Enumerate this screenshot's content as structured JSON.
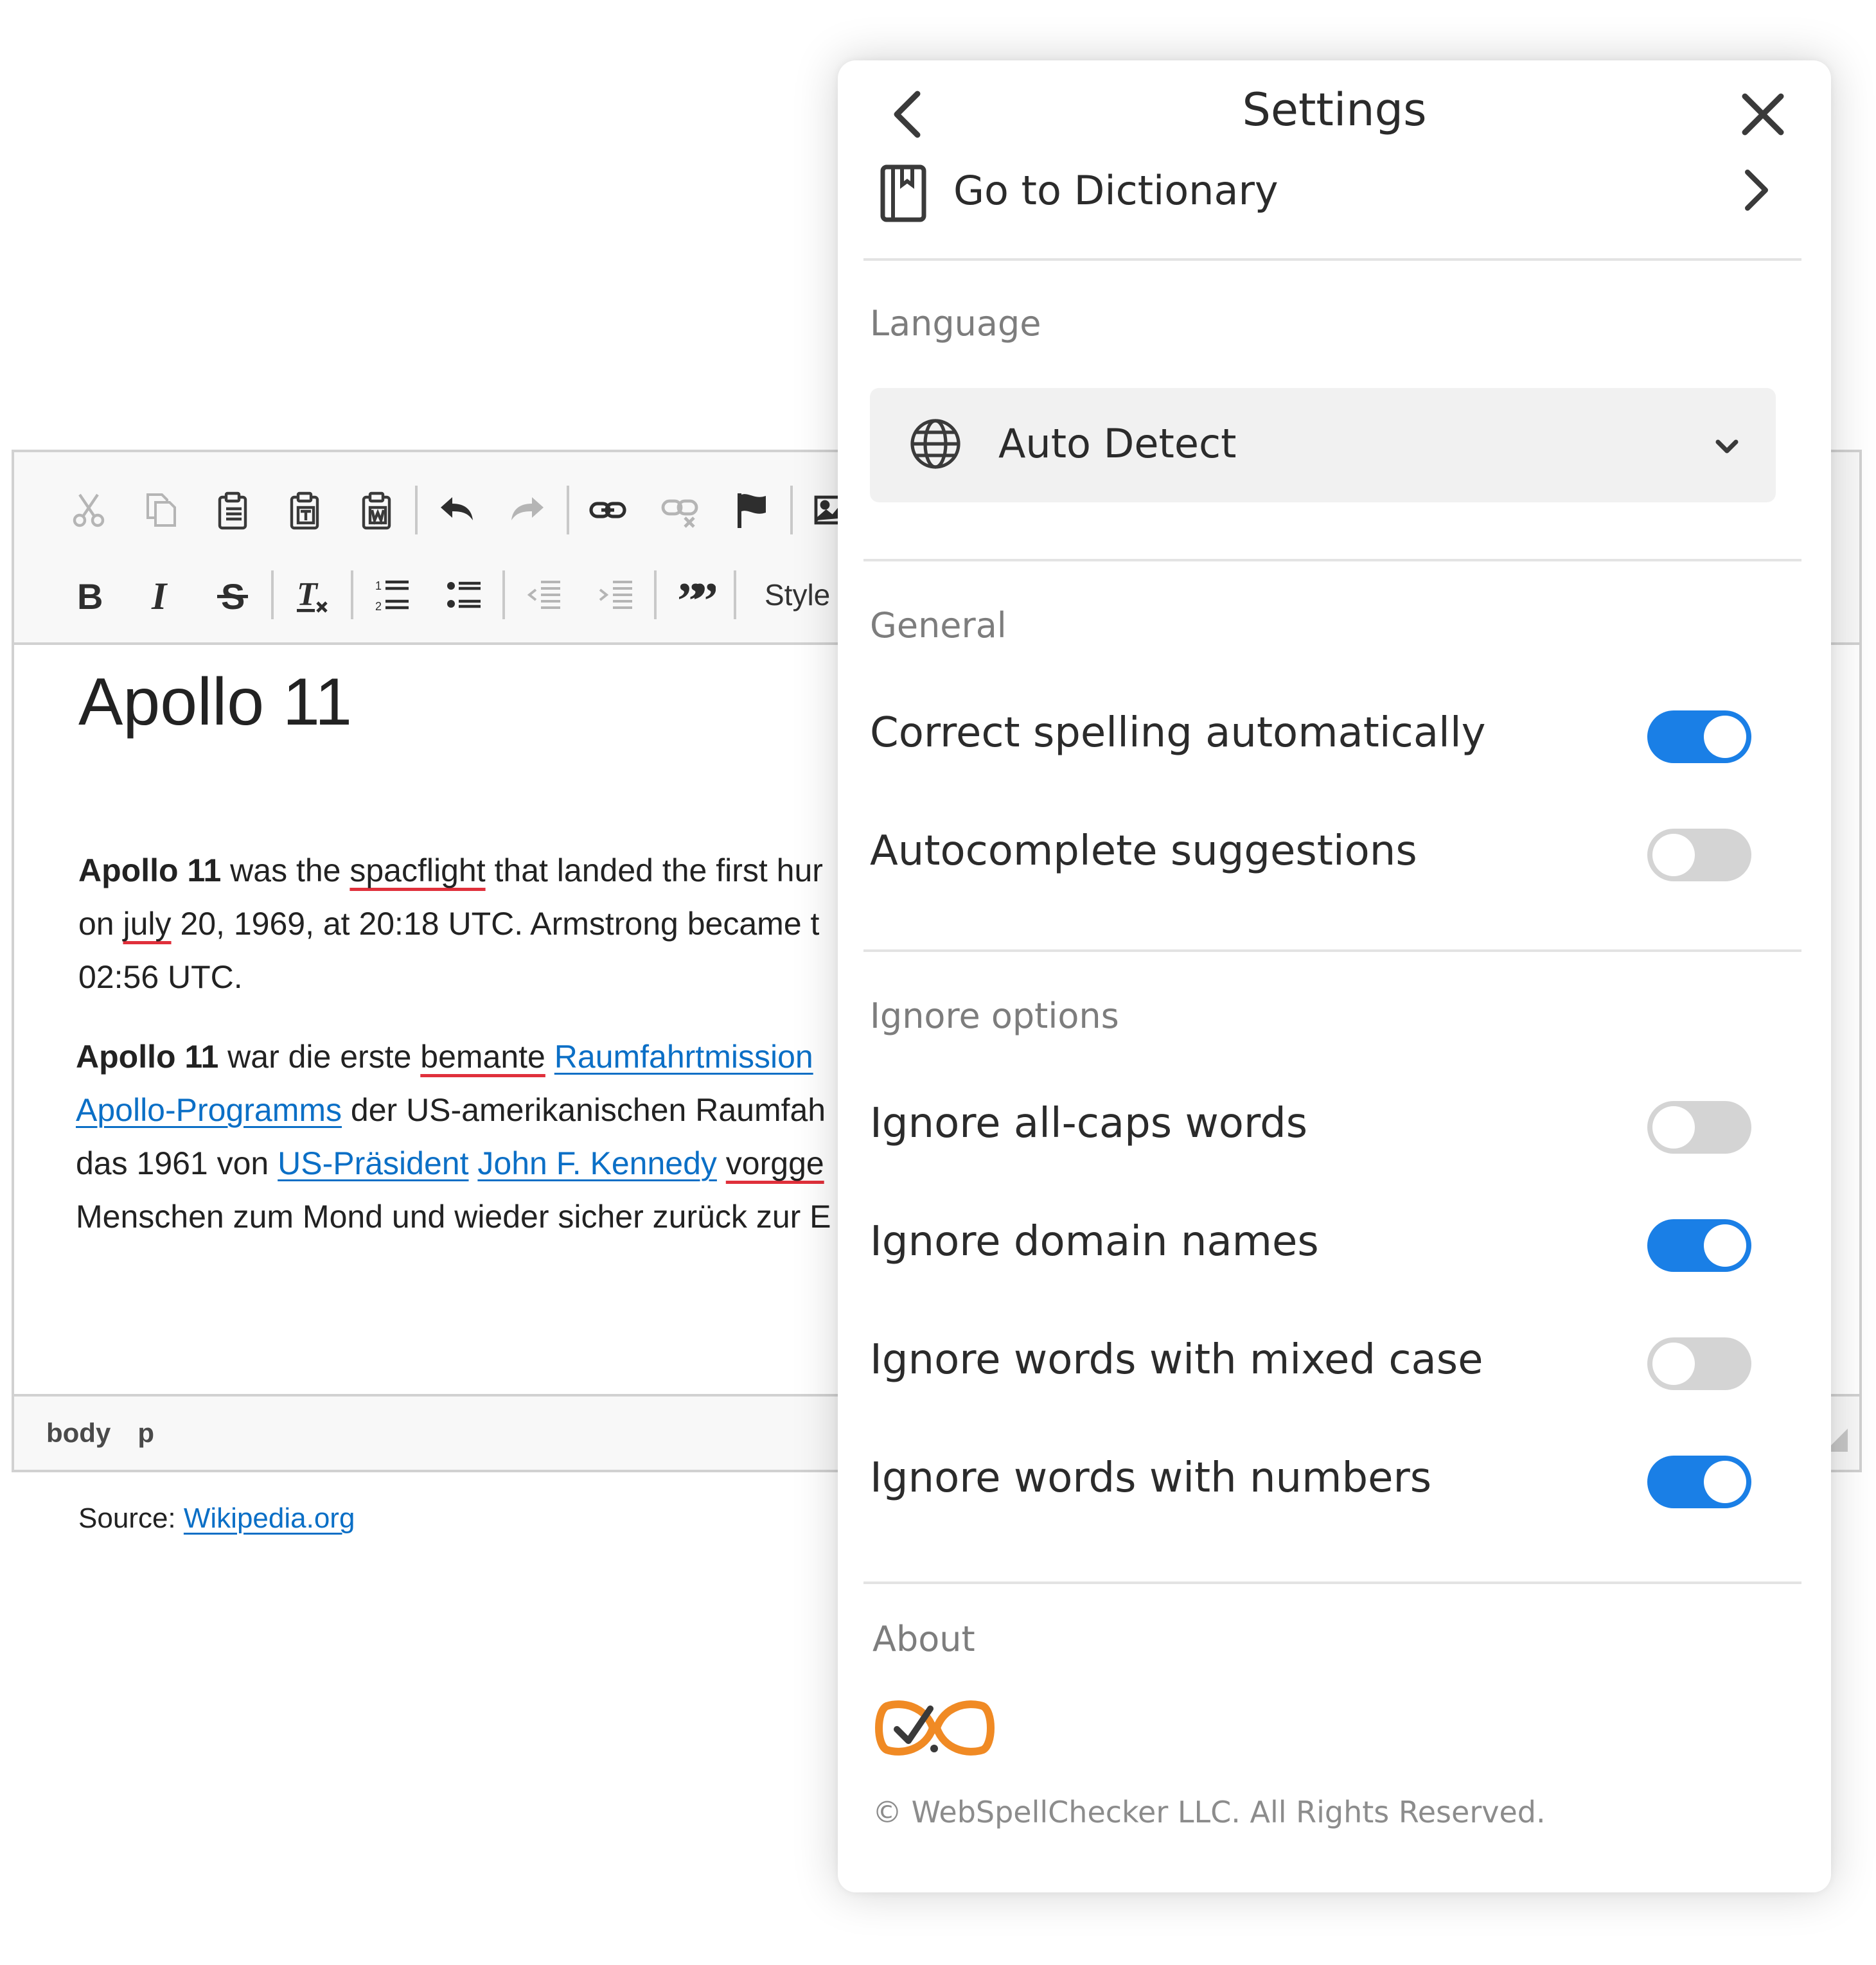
{
  "editor": {
    "toolbar": {
      "row1_icons": [
        "cut-icon",
        "copy-icon",
        "paste-icon",
        "paste-text-icon",
        "paste-word-icon",
        "undo-icon",
        "redo-icon",
        "link-icon",
        "unlink-icon",
        "anchor-flag-icon",
        "image-icon"
      ],
      "row2_icons": [
        "bold-icon",
        "italic-icon",
        "strikethrough-icon",
        "remove-format-icon",
        "numbered-list-icon",
        "bulleted-list-icon",
        "outdent-icon",
        "indent-icon",
        "blockquote-icon"
      ],
      "styles_label": "Style"
    },
    "heading": "Apollo 11",
    "para1": {
      "bold": "Apollo 11",
      "t1": " was the ",
      "misspelled1": "spacflight",
      "t2": " that landed the first hur",
      "line2_a": "on ",
      "misspelled2": "july",
      "line2_b": " 20, 1969, at 20:18 UTC. Armstrong became t",
      "line3": "02:56 UTC."
    },
    "para2": {
      "bold": "Apollo 11",
      "t1": " war die erste ",
      "misspelled1": "bemante",
      "link1": "Raumfahrtmission",
      "link2": "Apollo-Programms",
      "t2": " der US-amerikanischen Raumfah",
      "t3": "das 1961 von ",
      "link3": "US-Präsident",
      "link4": "John F. Kennedy",
      "misspelled2": "vorgge",
      "line4": "Menschen zum Mond und wieder sicher zurück zur E"
    },
    "source_label": "Source: ",
    "source_link": "Wikipedia.org",
    "statusbar": [
      "body",
      "p"
    ]
  },
  "settings": {
    "title": "Settings",
    "dictionary_label": "Go to Dictionary",
    "language_section": "Language",
    "language_value": "Auto Detect",
    "general_section": "General",
    "general_options": [
      {
        "label": "Correct spelling automatically",
        "enabled": true
      },
      {
        "label": "Autocomplete suggestions",
        "enabled": false
      }
    ],
    "ignore_section": "Ignore options",
    "ignore_options": [
      {
        "label": "Ignore all-caps words",
        "enabled": false
      },
      {
        "label": "Ignore domain names",
        "enabled": true
      },
      {
        "label": "Ignore words with mixed case",
        "enabled": false
      },
      {
        "label": "Ignore words with numbers",
        "enabled": true
      }
    ],
    "about_section": "About",
    "copyright": "© WebSpellChecker LLC. All Rights Reserved.",
    "colors": {
      "toggle_on": "#1a7fe6",
      "toggle_off": "#d4d4d4",
      "logo_orange": "#f08a24",
      "link": "#0b6fc6",
      "misspell": "#e0303b"
    }
  }
}
